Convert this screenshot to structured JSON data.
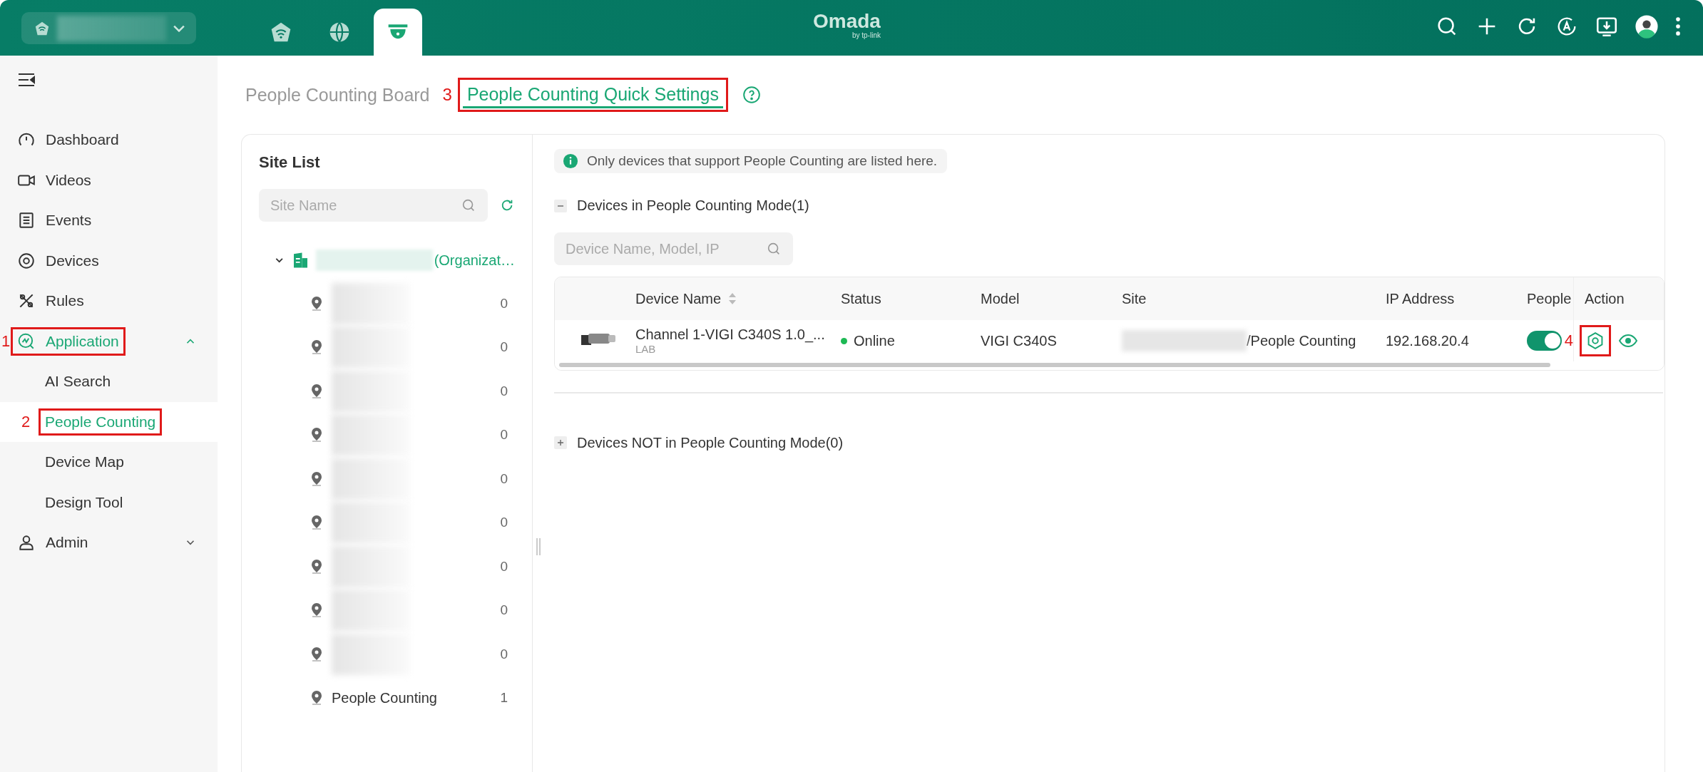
{
  "topbar": {
    "logo": "Omada",
    "logo_sub": "by tp-link",
    "tabs": [
      {
        "kind": "network",
        "selected": false
      },
      {
        "kind": "globe",
        "selected": false
      },
      {
        "kind": "camera",
        "selected": true
      }
    ]
  },
  "sidebar": {
    "items": [
      {
        "kind": "dashboard",
        "label": "Dashboard",
        "selected": false
      },
      {
        "kind": "videos",
        "label": "Videos",
        "selected": false
      },
      {
        "kind": "events",
        "label": "Events",
        "selected": false
      },
      {
        "kind": "devices",
        "label": "Devices",
        "selected": false
      },
      {
        "kind": "rules",
        "label": "Rules",
        "selected": false
      },
      {
        "kind": "application",
        "label": "Application",
        "selected": true,
        "expanded": true,
        "callout": "1",
        "children": [
          {
            "label": "AI Search",
            "selected": false
          },
          {
            "label": "People Counting",
            "selected": true,
            "callout": "2"
          },
          {
            "label": "Device Map",
            "selected": false
          },
          {
            "label": "Design Tool",
            "selected": false
          }
        ]
      },
      {
        "kind": "admin",
        "label": "Admin",
        "selected": false,
        "expanded": false
      }
    ]
  },
  "page_tabs": [
    {
      "label": "People Counting Board",
      "selected": false
    },
    {
      "label": "People Counting Quick Settings",
      "selected": true,
      "callout": "3"
    }
  ],
  "site_list": {
    "title": "Site List",
    "search": {
      "placeholder": "Site Name"
    },
    "tree": {
      "label": "(Organizat…",
      "expanded": true,
      "children": [
        {
          "redacted": true,
          "count": "0"
        },
        {
          "redacted": true,
          "count": "0"
        },
        {
          "redacted": true,
          "count": "0"
        },
        {
          "redacted": true,
          "count": "0"
        },
        {
          "redacted": true,
          "count": "0"
        },
        {
          "redacted": true,
          "count": "0"
        },
        {
          "redacted": true,
          "count": "0"
        },
        {
          "redacted": true,
          "count": "0"
        },
        {
          "redacted": true,
          "count": "0"
        },
        {
          "redacted": false,
          "label": "People Counting",
          "count": "1"
        }
      ]
    }
  },
  "notice": "Only devices that support People Counting are listed here.",
  "sections": [
    {
      "title": "Devices in People Counting Mode(1)",
      "expanded": true,
      "search": {
        "placeholder": "Device Name, Model, IP"
      },
      "table": {
        "columns": [
          "Device Name",
          "Status",
          "Model",
          "Site",
          "IP Address",
          "People",
          "Action"
        ],
        "rows": [
          {
            "name": "Channel 1-VIGI C340S 1.0_...",
            "sub": "LAB",
            "status": "Online",
            "color": "#1db954",
            "model": "VIGI C340S",
            "site": "/People Counting",
            "ip": "192.168.20.4",
            "people_on": true,
            "callout": "4"
          }
        ]
      }
    },
    {
      "title": "Devices NOT in People Counting Mode(0)",
      "expanded": false
    }
  ]
}
